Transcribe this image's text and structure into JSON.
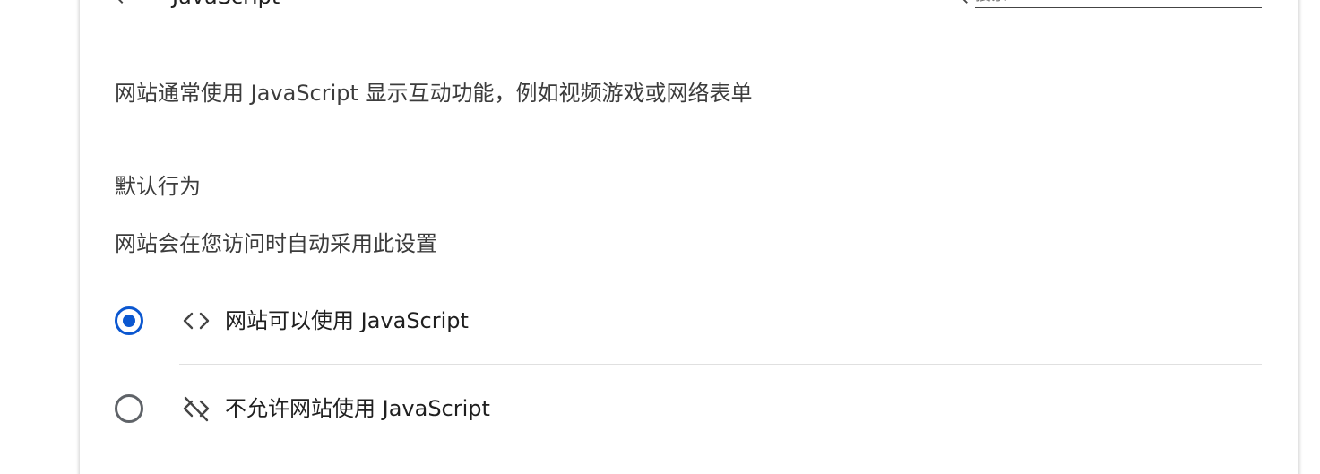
{
  "header": {
    "back_icon": "arrow-back-icon",
    "title": "JavaScript",
    "search_icon": "search-icon",
    "search_placeholder": "搜索"
  },
  "description": "网站通常使用 JavaScript 显示互动功能，例如视频游戏或网络表单",
  "default_behavior": {
    "title": "默认行为",
    "subtitle": "网站会在您访问时自动采用此设置"
  },
  "options": [
    {
      "label": "网站可以使用 JavaScript",
      "icon": "code-icon",
      "selected": true
    },
    {
      "label": "不允许网站使用 JavaScript",
      "icon": "code-off-icon",
      "selected": false
    }
  ],
  "colors": {
    "accent": "#0b57d0",
    "radio_unchecked": "#5f6368",
    "text": "#3c3c3c",
    "divider": "#e0e0e0"
  }
}
